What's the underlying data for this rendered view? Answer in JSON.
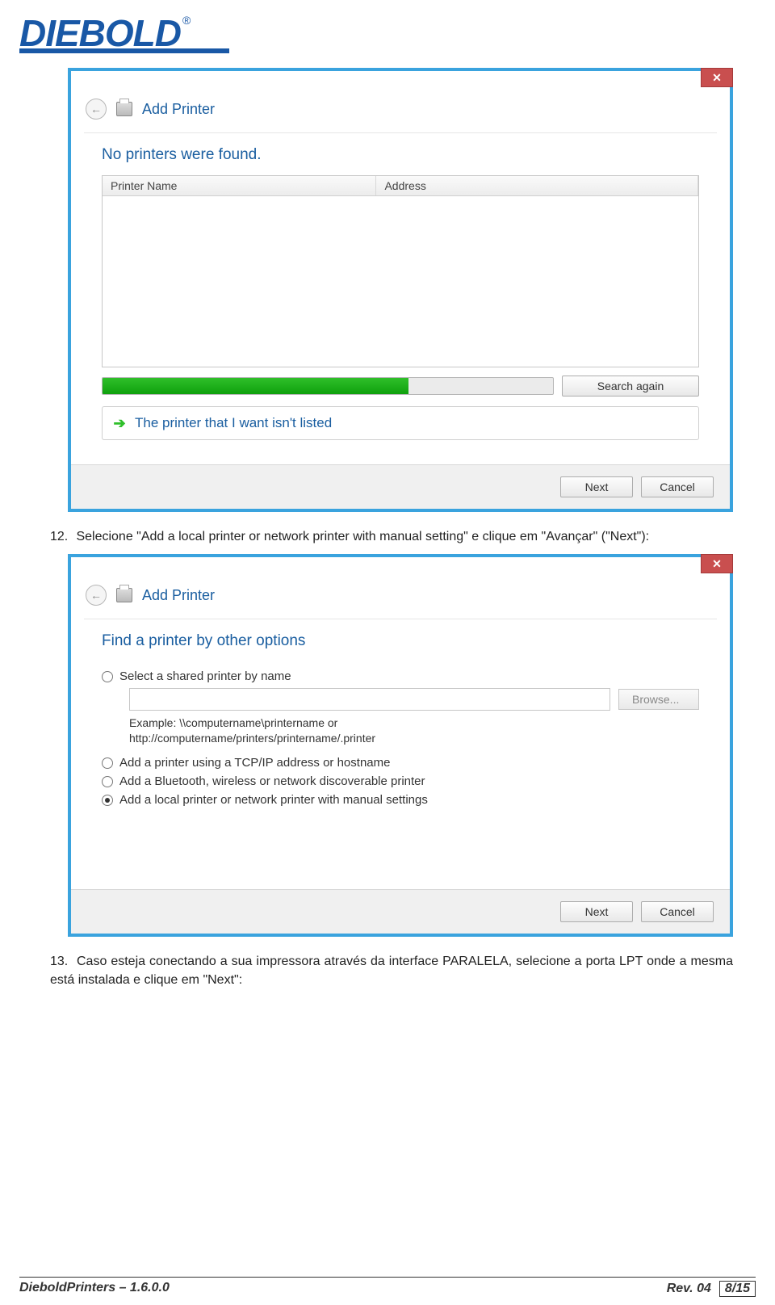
{
  "logo": {
    "text": "DIEBOLD",
    "reg": "®"
  },
  "dialog1": {
    "title": "Add Printer",
    "heading": "No printers were found.",
    "col_printer": "Printer Name",
    "col_address": "Address",
    "search_again": "Search again",
    "not_listed": "The printer that I want isn't listed",
    "next": "Next",
    "cancel": "Cancel"
  },
  "step12": {
    "num": "12.",
    "text": "Selecione \"Add a local printer or network printer with manual setting\" e clique em \"Avançar\" (\"Next\"):"
  },
  "dialog2": {
    "title": "Add Printer",
    "heading": "Find a printer by other options",
    "opt_shared": "Select a shared printer by name",
    "browse": "Browse...",
    "example1": "Example: \\\\computername\\printername or",
    "example2": "http://computername/printers/printername/.printer",
    "opt_tcpip": "Add a printer using a TCP/IP address or hostname",
    "opt_bt": "Add a Bluetooth, wireless or network discoverable printer",
    "opt_local": "Add a local printer or network printer with manual settings",
    "next": "Next",
    "cancel": "Cancel"
  },
  "step13": {
    "num": "13.",
    "text": "Caso esteja conectando a sua impressora através da interface PARALELA, selecione a porta LPT onde a mesma está instalada e clique em \"Next\":"
  },
  "footer": {
    "left": "DieboldPrinters – 1.6.0.0",
    "rev": "Rev. 04",
    "page": "8/15"
  }
}
